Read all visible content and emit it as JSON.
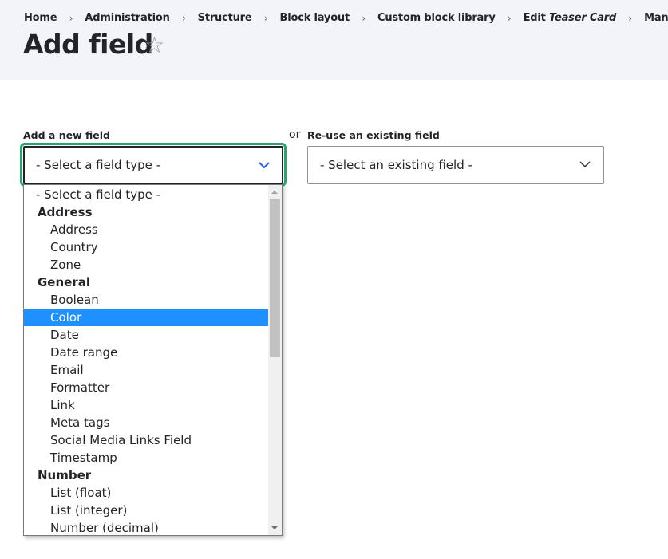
{
  "breadcrumb": [
    {
      "label": "Home"
    },
    {
      "label": "Administration"
    },
    {
      "label": "Structure"
    },
    {
      "label": "Block layout"
    },
    {
      "label": "Custom block library"
    },
    {
      "prefix": "Edit ",
      "label": "Teaser Card"
    },
    {
      "label": "Manage fields"
    }
  ],
  "breadcrumb_separator": "›",
  "page": {
    "title": "Add field",
    "favorite_icon": "☆"
  },
  "form": {
    "new_field": {
      "label": "Add a new field",
      "selected_value": "- Select a field type -"
    },
    "or_text": "or",
    "existing_field": {
      "label": "Re-use an existing field",
      "selected_value": "- Select an existing field -"
    }
  },
  "dropdown": {
    "highlighted": "Color",
    "options": [
      {
        "type": "placeholder",
        "label": "- Select a field type -"
      },
      {
        "type": "group",
        "label": "Address"
      },
      {
        "type": "item",
        "label": "Address"
      },
      {
        "type": "item",
        "label": "Country"
      },
      {
        "type": "item",
        "label": "Zone"
      },
      {
        "type": "group",
        "label": "General"
      },
      {
        "type": "item",
        "label": "Boolean"
      },
      {
        "type": "item",
        "label": "Color",
        "selected": true
      },
      {
        "type": "item",
        "label": "Date"
      },
      {
        "type": "item",
        "label": "Date range"
      },
      {
        "type": "item",
        "label": "Email"
      },
      {
        "type": "item",
        "label": "Formatter"
      },
      {
        "type": "item",
        "label": "Link"
      },
      {
        "type": "item",
        "label": "Meta tags"
      },
      {
        "type": "item",
        "label": "Social Media Links Field"
      },
      {
        "type": "item",
        "label": "Timestamp"
      },
      {
        "type": "group",
        "label": "Number"
      },
      {
        "type": "item",
        "label": "List (float)"
      },
      {
        "type": "item",
        "label": "List (integer)"
      },
      {
        "type": "item",
        "label": "Number (decimal)"
      }
    ],
    "scroll_position": 0
  },
  "colors": {
    "focus_ring": "#26a769",
    "selection": "#1e90ff",
    "chevron_active": "#2563eb",
    "header_bg": "#f3f4f9"
  }
}
